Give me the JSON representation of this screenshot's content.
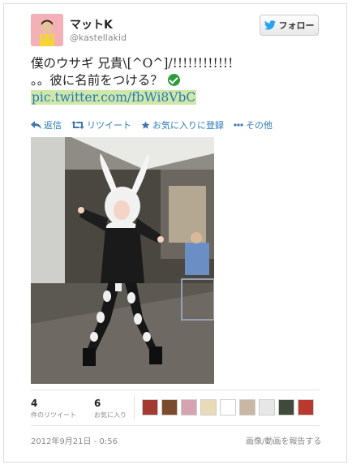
{
  "tweet": {
    "author_name": "マットK",
    "author_handle": "@kastellakid",
    "follow_label": "フォロー",
    "text_line1": "僕のウサギ 兄貴\\[^O^]/!!!!!!!!!!!!",
    "text_line2": "。。彼に名前をつける？",
    "link": "pic.twitter.com/fbWi8VbC"
  },
  "actions": {
    "reply": "返信",
    "retweet": "リツイート",
    "favorite": "お気に入りに登録",
    "more": "その他"
  },
  "stats": {
    "retweets_count": "4",
    "retweets_label": "件のリツイート",
    "favorites_count": "6",
    "favorites_label": "お気に入り"
  },
  "footer": {
    "timestamp": "2012年9月21日 - 0:56",
    "report_label": "画像/動画を報告する"
  },
  "colors": {
    "link_highlight": "#cfe8a9",
    "link_text": "#2a7ab5",
    "action_text": "#2a7ab5"
  },
  "icons": {
    "follow": "twitter-bird-icon",
    "reply": "reply-arrow-icon",
    "retweet": "retweet-icon",
    "favorite": "star-icon",
    "more": "more-dots-icon",
    "verified": "check-circle-icon"
  }
}
